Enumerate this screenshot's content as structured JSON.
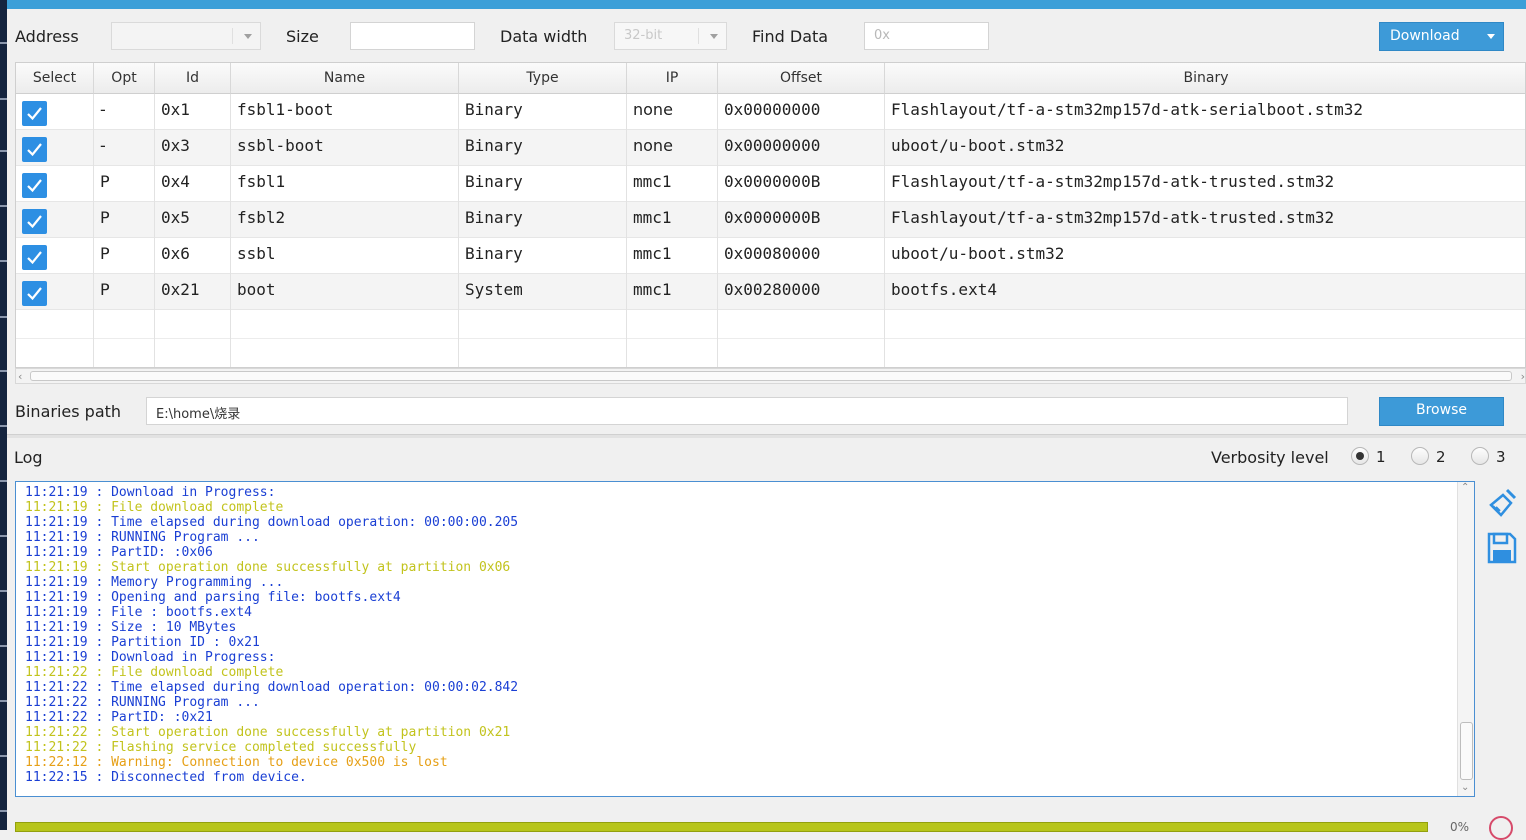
{
  "colors": {
    "accent_blue": "#3d9ad8",
    "log_blue": "#1a3fd4",
    "log_yellow": "#c2c31d",
    "log_orange": "#e6a017",
    "progress_fill": "#b7c51b"
  },
  "toolbar": {
    "address_label": "Address",
    "size_label": "Size",
    "data_width_label": "Data width",
    "data_width_value": "32-bit",
    "find_data_label": "Find Data",
    "find_data_placeholder": "0x",
    "download_label": "Download"
  },
  "table": {
    "headers": [
      "Select",
      "Opt",
      "Id",
      "Name",
      "Type",
      "IP",
      "Offset",
      "Binary"
    ],
    "rows": [
      {
        "opt": "-",
        "id": "0x1",
        "name": "fsbl1-boot",
        "type": "Binary",
        "ip": "none",
        "offset": "0x00000000",
        "binary": "Flashlayout/tf-a-stm32mp157d-atk-serialboot.stm32"
      },
      {
        "opt": "-",
        "id": "0x3",
        "name": "ssbl-boot",
        "type": "Binary",
        "ip": "none",
        "offset": "0x00000000",
        "binary": "uboot/u-boot.stm32"
      },
      {
        "opt": "P",
        "id": "0x4",
        "name": "fsbl1",
        "type": "Binary",
        "ip": "mmc1",
        "offset": "0x0000000B",
        "binary": "Flashlayout/tf-a-stm32mp157d-atk-trusted.stm32"
      },
      {
        "opt": "P",
        "id": "0x5",
        "name": "fsbl2",
        "type": "Binary",
        "ip": "mmc1",
        "offset": "0x0000000B",
        "binary": "Flashlayout/tf-a-stm32mp157d-atk-trusted.stm32"
      },
      {
        "opt": "P",
        "id": "0x6",
        "name": "ssbl",
        "type": "Binary",
        "ip": "mmc1",
        "offset": "0x00080000",
        "binary": "uboot/u-boot.stm32"
      },
      {
        "opt": "P",
        "id": "0x21",
        "name": "boot",
        "type": "System",
        "ip": "mmc1",
        "offset": "0x00280000",
        "binary": "bootfs.ext4"
      }
    ]
  },
  "binaries": {
    "label": "Binaries path",
    "path": "E:\\home\\烧录",
    "browse_label": "Browse"
  },
  "log": {
    "label": "Log",
    "verbosity_label": "Verbosity level",
    "verbosity_options": [
      "1",
      "2",
      "3"
    ],
    "lines": [
      {
        "text": "11:21:19 : Download in Progress:",
        "color": "blue"
      },
      {
        "text": "11:21:19 : File download complete",
        "color": "yellow"
      },
      {
        "text": "11:21:19 : Time elapsed during download operation: 00:00:00.205",
        "color": "blue"
      },
      {
        "text": "11:21:19 : RUNNING Program ...",
        "color": "blue"
      },
      {
        "text": "11:21:19 : PartID: :0x06",
        "color": "blue"
      },
      {
        "text": "11:21:19 : Start operation done successfully at partition 0x06",
        "color": "yellow"
      },
      {
        "text": "11:21:19 : Memory Programming ...",
        "color": "blue"
      },
      {
        "text": "11:21:19 : Opening and parsing file: bootfs.ext4",
        "color": "blue"
      },
      {
        "text": "11:21:19 : File : bootfs.ext4",
        "color": "blue"
      },
      {
        "text": "11:21:19 : Size : 10 MBytes",
        "color": "blue"
      },
      {
        "text": "11:21:19 : Partition ID : 0x21",
        "color": "blue"
      },
      {
        "text": "11:21:19 : Download in Progress:",
        "color": "blue"
      },
      {
        "text": "11:21:22 : File download complete",
        "color": "yellow"
      },
      {
        "text": "11:21:22 : Time elapsed during download operation: 00:00:02.842",
        "color": "blue"
      },
      {
        "text": "11:21:22 : RUNNING Program ...",
        "color": "blue"
      },
      {
        "text": "11:21:22 : PartID: :0x21",
        "color": "blue"
      },
      {
        "text": "11:21:22 : Start operation done successfully at partition 0x21",
        "color": "yellow"
      },
      {
        "text": "11:21:22 : Flashing service completed successfully",
        "color": "yellow"
      },
      {
        "text": "11:22:12 : Warning: Connection to device 0x500 is lost",
        "color": "orange"
      },
      {
        "text": "11:22:15 : Disconnected from device.",
        "color": "blue"
      }
    ]
  },
  "progress": {
    "percent_label": "0%"
  },
  "icons": {
    "clear": "broom-icon",
    "save": "floppy-disk-icon",
    "cancel": "cancel-circle-icon"
  }
}
